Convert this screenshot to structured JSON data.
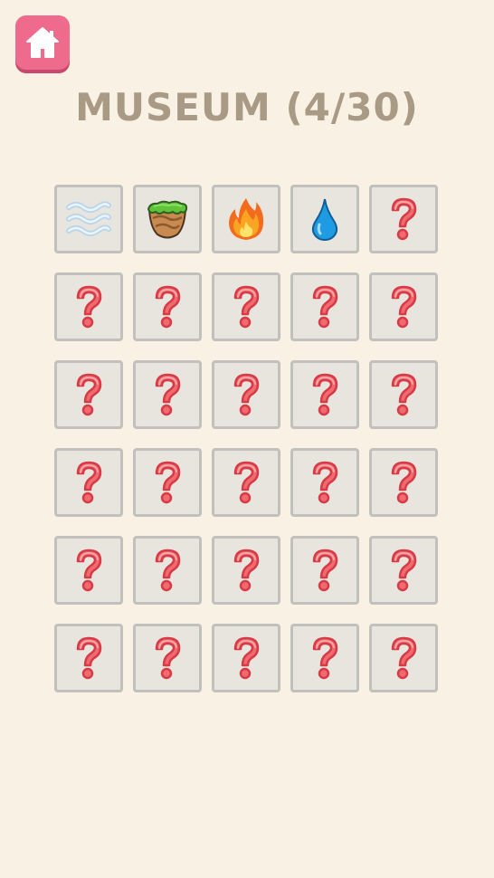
{
  "header": {
    "title": "MUSEUM (4/30)",
    "home_icon": "home-icon"
  },
  "colors": {
    "background": "#f9f1e3",
    "home_button": "#ef6b8e",
    "title": "#a89a85",
    "tile_bg": "#e8e4de",
    "tile_border": "#c2c0bc",
    "unknown_mark": "#e9505a"
  },
  "museum": {
    "discovered": 4,
    "total": 30,
    "columns": 5,
    "items": [
      {
        "state": "discovered",
        "icon": "air-icon"
      },
      {
        "state": "discovered",
        "icon": "earth-icon"
      },
      {
        "state": "discovered",
        "icon": "fire-icon"
      },
      {
        "state": "discovered",
        "icon": "water-icon"
      },
      {
        "state": "locked",
        "icon": "question-mark-icon"
      },
      {
        "state": "locked",
        "icon": "question-mark-icon"
      },
      {
        "state": "locked",
        "icon": "question-mark-icon"
      },
      {
        "state": "locked",
        "icon": "question-mark-icon"
      },
      {
        "state": "locked",
        "icon": "question-mark-icon"
      },
      {
        "state": "locked",
        "icon": "question-mark-icon"
      },
      {
        "state": "locked",
        "icon": "question-mark-icon"
      },
      {
        "state": "locked",
        "icon": "question-mark-icon"
      },
      {
        "state": "locked",
        "icon": "question-mark-icon"
      },
      {
        "state": "locked",
        "icon": "question-mark-icon"
      },
      {
        "state": "locked",
        "icon": "question-mark-icon"
      },
      {
        "state": "locked",
        "icon": "question-mark-icon"
      },
      {
        "state": "locked",
        "icon": "question-mark-icon"
      },
      {
        "state": "locked",
        "icon": "question-mark-icon"
      },
      {
        "state": "locked",
        "icon": "question-mark-icon"
      },
      {
        "state": "locked",
        "icon": "question-mark-icon"
      },
      {
        "state": "locked",
        "icon": "question-mark-icon"
      },
      {
        "state": "locked",
        "icon": "question-mark-icon"
      },
      {
        "state": "locked",
        "icon": "question-mark-icon"
      },
      {
        "state": "locked",
        "icon": "question-mark-icon"
      },
      {
        "state": "locked",
        "icon": "question-mark-icon"
      },
      {
        "state": "locked",
        "icon": "question-mark-icon"
      },
      {
        "state": "locked",
        "icon": "question-mark-icon"
      },
      {
        "state": "locked",
        "icon": "question-mark-icon"
      },
      {
        "state": "locked",
        "icon": "question-mark-icon"
      },
      {
        "state": "locked",
        "icon": "question-mark-icon"
      }
    ]
  }
}
